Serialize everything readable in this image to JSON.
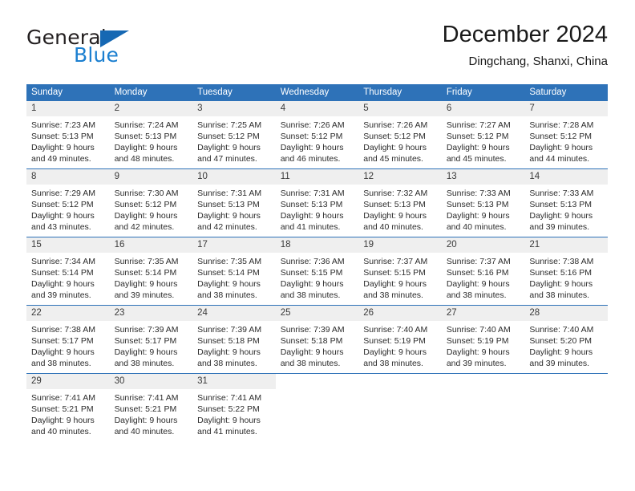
{
  "brand": {
    "name_top": "General",
    "name_bottom": "Blue",
    "colors": {
      "top_text": "#231f20",
      "bottom_text": "#1b7fd0",
      "triangle": "#1668b3"
    }
  },
  "header": {
    "title": "December 2024",
    "subtitle": "Dingchang, Shanxi, China"
  },
  "theme": {
    "header_row_bg": "#2e72b8",
    "header_row_text": "#ffffff",
    "daynum_bg": "#efefef",
    "grid_line": "#2e72b8",
    "body_text": "#2b2b2b"
  },
  "weekdays": [
    "Sunday",
    "Monday",
    "Tuesday",
    "Wednesday",
    "Thursday",
    "Friday",
    "Saturday"
  ],
  "labels": {
    "sunrise": "Sunrise:",
    "sunset": "Sunset:",
    "daylight": "Daylight:"
  },
  "weeks": [
    [
      {
        "day": "1",
        "sunrise": "Sunrise: 7:23 AM",
        "sunset": "Sunset: 5:13 PM",
        "daylight1": "Daylight: 9 hours",
        "daylight2": "and 49 minutes."
      },
      {
        "day": "2",
        "sunrise": "Sunrise: 7:24 AM",
        "sunset": "Sunset: 5:13 PM",
        "daylight1": "Daylight: 9 hours",
        "daylight2": "and 48 minutes."
      },
      {
        "day": "3",
        "sunrise": "Sunrise: 7:25 AM",
        "sunset": "Sunset: 5:12 PM",
        "daylight1": "Daylight: 9 hours",
        "daylight2": "and 47 minutes."
      },
      {
        "day": "4",
        "sunrise": "Sunrise: 7:26 AM",
        "sunset": "Sunset: 5:12 PM",
        "daylight1": "Daylight: 9 hours",
        "daylight2": "and 46 minutes."
      },
      {
        "day": "5",
        "sunrise": "Sunrise: 7:26 AM",
        "sunset": "Sunset: 5:12 PM",
        "daylight1": "Daylight: 9 hours",
        "daylight2": "and 45 minutes."
      },
      {
        "day": "6",
        "sunrise": "Sunrise: 7:27 AM",
        "sunset": "Sunset: 5:12 PM",
        "daylight1": "Daylight: 9 hours",
        "daylight2": "and 45 minutes."
      },
      {
        "day": "7",
        "sunrise": "Sunrise: 7:28 AM",
        "sunset": "Sunset: 5:12 PM",
        "daylight1": "Daylight: 9 hours",
        "daylight2": "and 44 minutes."
      }
    ],
    [
      {
        "day": "8",
        "sunrise": "Sunrise: 7:29 AM",
        "sunset": "Sunset: 5:12 PM",
        "daylight1": "Daylight: 9 hours",
        "daylight2": "and 43 minutes."
      },
      {
        "day": "9",
        "sunrise": "Sunrise: 7:30 AM",
        "sunset": "Sunset: 5:12 PM",
        "daylight1": "Daylight: 9 hours",
        "daylight2": "and 42 minutes."
      },
      {
        "day": "10",
        "sunrise": "Sunrise: 7:31 AM",
        "sunset": "Sunset: 5:13 PM",
        "daylight1": "Daylight: 9 hours",
        "daylight2": "and 42 minutes."
      },
      {
        "day": "11",
        "sunrise": "Sunrise: 7:31 AM",
        "sunset": "Sunset: 5:13 PM",
        "daylight1": "Daylight: 9 hours",
        "daylight2": "and 41 minutes."
      },
      {
        "day": "12",
        "sunrise": "Sunrise: 7:32 AM",
        "sunset": "Sunset: 5:13 PM",
        "daylight1": "Daylight: 9 hours",
        "daylight2": "and 40 minutes."
      },
      {
        "day": "13",
        "sunrise": "Sunrise: 7:33 AM",
        "sunset": "Sunset: 5:13 PM",
        "daylight1": "Daylight: 9 hours",
        "daylight2": "and 40 minutes."
      },
      {
        "day": "14",
        "sunrise": "Sunrise: 7:33 AM",
        "sunset": "Sunset: 5:13 PM",
        "daylight1": "Daylight: 9 hours",
        "daylight2": "and 39 minutes."
      }
    ],
    [
      {
        "day": "15",
        "sunrise": "Sunrise: 7:34 AM",
        "sunset": "Sunset: 5:14 PM",
        "daylight1": "Daylight: 9 hours",
        "daylight2": "and 39 minutes."
      },
      {
        "day": "16",
        "sunrise": "Sunrise: 7:35 AM",
        "sunset": "Sunset: 5:14 PM",
        "daylight1": "Daylight: 9 hours",
        "daylight2": "and 39 minutes."
      },
      {
        "day": "17",
        "sunrise": "Sunrise: 7:35 AM",
        "sunset": "Sunset: 5:14 PM",
        "daylight1": "Daylight: 9 hours",
        "daylight2": "and 38 minutes."
      },
      {
        "day": "18",
        "sunrise": "Sunrise: 7:36 AM",
        "sunset": "Sunset: 5:15 PM",
        "daylight1": "Daylight: 9 hours",
        "daylight2": "and 38 minutes."
      },
      {
        "day": "19",
        "sunrise": "Sunrise: 7:37 AM",
        "sunset": "Sunset: 5:15 PM",
        "daylight1": "Daylight: 9 hours",
        "daylight2": "and 38 minutes."
      },
      {
        "day": "20",
        "sunrise": "Sunrise: 7:37 AM",
        "sunset": "Sunset: 5:16 PM",
        "daylight1": "Daylight: 9 hours",
        "daylight2": "and 38 minutes."
      },
      {
        "day": "21",
        "sunrise": "Sunrise: 7:38 AM",
        "sunset": "Sunset: 5:16 PM",
        "daylight1": "Daylight: 9 hours",
        "daylight2": "and 38 minutes."
      }
    ],
    [
      {
        "day": "22",
        "sunrise": "Sunrise: 7:38 AM",
        "sunset": "Sunset: 5:17 PM",
        "daylight1": "Daylight: 9 hours",
        "daylight2": "and 38 minutes."
      },
      {
        "day": "23",
        "sunrise": "Sunrise: 7:39 AM",
        "sunset": "Sunset: 5:17 PM",
        "daylight1": "Daylight: 9 hours",
        "daylight2": "and 38 minutes."
      },
      {
        "day": "24",
        "sunrise": "Sunrise: 7:39 AM",
        "sunset": "Sunset: 5:18 PM",
        "daylight1": "Daylight: 9 hours",
        "daylight2": "and 38 minutes."
      },
      {
        "day": "25",
        "sunrise": "Sunrise: 7:39 AM",
        "sunset": "Sunset: 5:18 PM",
        "daylight1": "Daylight: 9 hours",
        "daylight2": "and 38 minutes."
      },
      {
        "day": "26",
        "sunrise": "Sunrise: 7:40 AM",
        "sunset": "Sunset: 5:19 PM",
        "daylight1": "Daylight: 9 hours",
        "daylight2": "and 38 minutes."
      },
      {
        "day": "27",
        "sunrise": "Sunrise: 7:40 AM",
        "sunset": "Sunset: 5:19 PM",
        "daylight1": "Daylight: 9 hours",
        "daylight2": "and 39 minutes."
      },
      {
        "day": "28",
        "sunrise": "Sunrise: 7:40 AM",
        "sunset": "Sunset: 5:20 PM",
        "daylight1": "Daylight: 9 hours",
        "daylight2": "and 39 minutes."
      }
    ],
    [
      {
        "day": "29",
        "sunrise": "Sunrise: 7:41 AM",
        "sunset": "Sunset: 5:21 PM",
        "daylight1": "Daylight: 9 hours",
        "daylight2": "and 40 minutes."
      },
      {
        "day": "30",
        "sunrise": "Sunrise: 7:41 AM",
        "sunset": "Sunset: 5:21 PM",
        "daylight1": "Daylight: 9 hours",
        "daylight2": "and 40 minutes."
      },
      {
        "day": "31",
        "sunrise": "Sunrise: 7:41 AM",
        "sunset": "Sunset: 5:22 PM",
        "daylight1": "Daylight: 9 hours",
        "daylight2": "and 41 minutes."
      },
      {
        "day": "",
        "sunrise": "",
        "sunset": "",
        "daylight1": "",
        "daylight2": ""
      },
      {
        "day": "",
        "sunrise": "",
        "sunset": "",
        "daylight1": "",
        "daylight2": ""
      },
      {
        "day": "",
        "sunrise": "",
        "sunset": "",
        "daylight1": "",
        "daylight2": ""
      },
      {
        "day": "",
        "sunrise": "",
        "sunset": "",
        "daylight1": "",
        "daylight2": ""
      }
    ]
  ]
}
